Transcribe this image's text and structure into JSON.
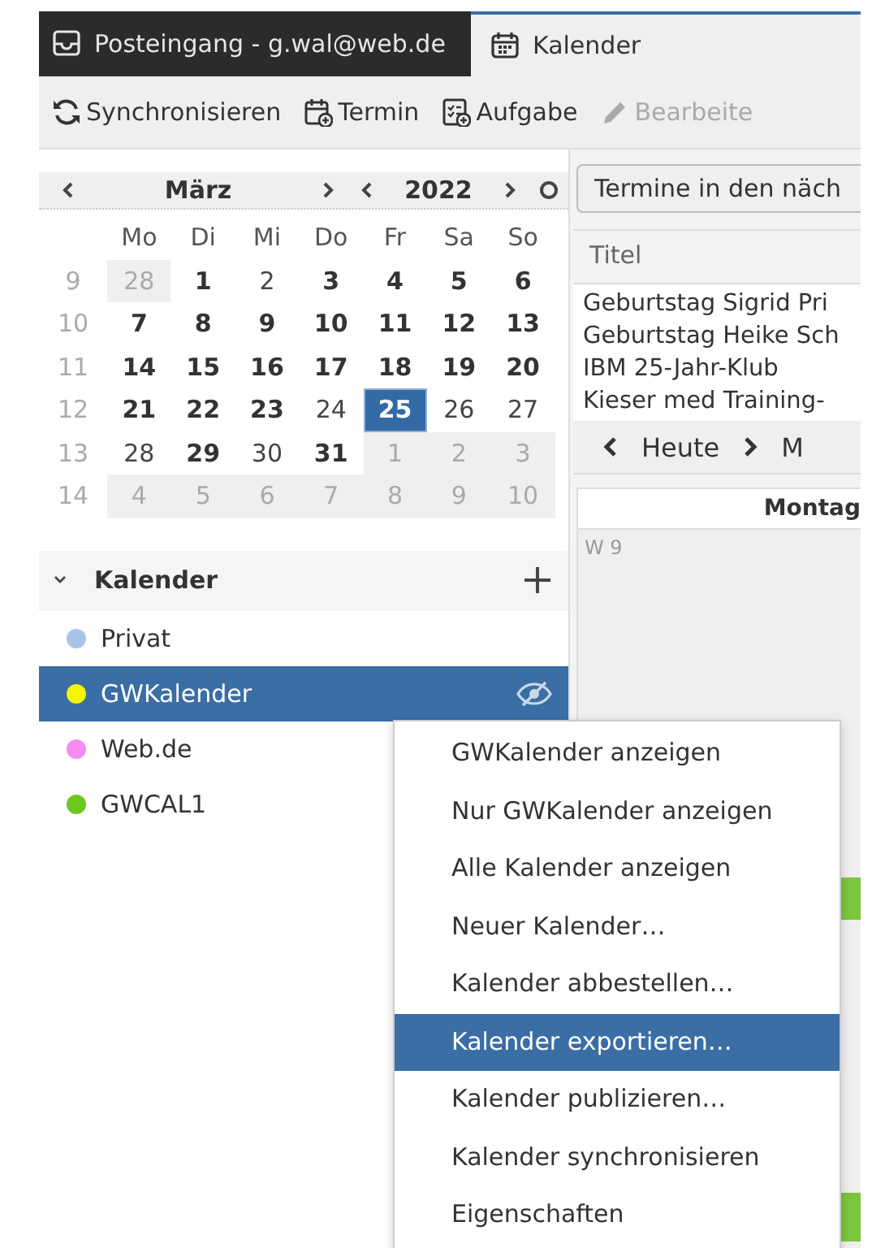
{
  "tabs": [
    {
      "label": "Posteingang - g.wal@web.de",
      "kind": "mail",
      "selected": false
    },
    {
      "label": "Kalender",
      "kind": "calendar",
      "selected": true
    }
  ],
  "toolbar": [
    {
      "label": "Synchronisieren",
      "kind": "sync",
      "disabled": false
    },
    {
      "label": "Termin",
      "kind": "event",
      "disabled": false
    },
    {
      "label": "Aufgabe",
      "kind": "task",
      "disabled": false
    },
    {
      "label": "Bearbeite",
      "kind": "edit",
      "disabled": true
    }
  ],
  "minimonth": {
    "month": "März",
    "year": "2022",
    "weekdays": [
      "Mo",
      "Di",
      "Mi",
      "Do",
      "Fr",
      "Sa",
      "So"
    ],
    "weeks": [
      {
        "number": "9",
        "days": [
          {
            "day": "28",
            "other_month": true,
            "bold": false,
            "selected": false
          },
          {
            "day": "1",
            "other_month": false,
            "bold": true,
            "selected": false
          },
          {
            "day": "2",
            "other_month": false,
            "bold": false,
            "selected": false
          },
          {
            "day": "3",
            "other_month": false,
            "bold": true,
            "selected": false
          },
          {
            "day": "4",
            "other_month": false,
            "bold": true,
            "selected": false
          },
          {
            "day": "5",
            "other_month": false,
            "bold": true,
            "selected": false
          },
          {
            "day": "6",
            "other_month": false,
            "bold": true,
            "selected": false
          }
        ]
      },
      {
        "number": "10",
        "days": [
          {
            "day": "7",
            "other_month": false,
            "bold": true,
            "selected": false
          },
          {
            "day": "8",
            "other_month": false,
            "bold": true,
            "selected": false
          },
          {
            "day": "9",
            "other_month": false,
            "bold": true,
            "selected": false
          },
          {
            "day": "10",
            "other_month": false,
            "bold": true,
            "selected": false
          },
          {
            "day": "11",
            "other_month": false,
            "bold": true,
            "selected": false
          },
          {
            "day": "12",
            "other_month": false,
            "bold": true,
            "selected": false
          },
          {
            "day": "13",
            "other_month": false,
            "bold": true,
            "selected": false
          }
        ]
      },
      {
        "number": "11",
        "days": [
          {
            "day": "14",
            "other_month": false,
            "bold": true,
            "selected": false
          },
          {
            "day": "15",
            "other_month": false,
            "bold": true,
            "selected": false
          },
          {
            "day": "16",
            "other_month": false,
            "bold": true,
            "selected": false
          },
          {
            "day": "17",
            "other_month": false,
            "bold": true,
            "selected": false
          },
          {
            "day": "18",
            "other_month": false,
            "bold": true,
            "selected": false
          },
          {
            "day": "19",
            "other_month": false,
            "bold": true,
            "selected": false
          },
          {
            "day": "20",
            "other_month": false,
            "bold": true,
            "selected": false
          }
        ]
      },
      {
        "number": "12",
        "days": [
          {
            "day": "21",
            "other_month": false,
            "bold": true,
            "selected": false
          },
          {
            "day": "22",
            "other_month": false,
            "bold": true,
            "selected": false
          },
          {
            "day": "23",
            "other_month": false,
            "bold": true,
            "selected": false
          },
          {
            "day": "24",
            "other_month": false,
            "bold": false,
            "selected": false
          },
          {
            "day": "25",
            "other_month": false,
            "bold": true,
            "selected": true
          },
          {
            "day": "26",
            "other_month": false,
            "bold": false,
            "selected": false
          },
          {
            "day": "27",
            "other_month": false,
            "bold": false,
            "selected": false
          }
        ]
      },
      {
        "number": "13",
        "days": [
          {
            "day": "28",
            "other_month": false,
            "bold": false,
            "selected": false
          },
          {
            "day": "29",
            "other_month": false,
            "bold": true,
            "selected": false
          },
          {
            "day": "30",
            "other_month": false,
            "bold": false,
            "selected": false
          },
          {
            "day": "31",
            "other_month": false,
            "bold": true,
            "selected": false
          },
          {
            "day": "1",
            "other_month": true,
            "bold": false,
            "selected": false
          },
          {
            "day": "2",
            "other_month": true,
            "bold": false,
            "selected": false
          },
          {
            "day": "3",
            "other_month": true,
            "bold": false,
            "selected": false
          }
        ]
      },
      {
        "number": "14",
        "days": [
          {
            "day": "4",
            "other_month": true,
            "bold": false,
            "selected": false
          },
          {
            "day": "5",
            "other_month": true,
            "bold": false,
            "selected": false
          },
          {
            "day": "6",
            "other_month": true,
            "bold": false,
            "selected": false
          },
          {
            "day": "7",
            "other_month": true,
            "bold": false,
            "selected": false
          },
          {
            "day": "8",
            "other_month": true,
            "bold": false,
            "selected": false
          },
          {
            "day": "9",
            "other_month": true,
            "bold": false,
            "selected": false
          },
          {
            "day": "10",
            "other_month": true,
            "bold": false,
            "selected": false
          }
        ]
      }
    ]
  },
  "calendars": {
    "title": "Kalender",
    "expanded": true,
    "items": [
      {
        "name": "Privat",
        "color": "#a8c4e6",
        "selected": false,
        "hidden": false
      },
      {
        "name": "GWKalender",
        "color": "#f5f500",
        "selected": true,
        "hidden": true
      },
      {
        "name": "Web.de",
        "color": "#f58cf0",
        "selected": false,
        "hidden": false
      },
      {
        "name": "GWCAL1",
        "color": "#6cc81e",
        "selected": false,
        "hidden": false
      }
    ]
  },
  "agenda": {
    "filter": "Termine in den näch",
    "column": "Titel",
    "rows": [
      "Geburtstag Sigrid Pri",
      "Geburtstag Heike Sch",
      "IBM 25-Jahr-Klub",
      "Kieser med Training-"
    ]
  },
  "view_nav": {
    "today": "Heute",
    "next_label": "M"
  },
  "day_header": "Montag",
  "week_label": "W 9",
  "context_menu": [
    {
      "label": "GWKalender anzeigen",
      "selected": false
    },
    {
      "label": "Nur GWKalender anzeigen",
      "selected": false
    },
    {
      "label": "Alle Kalender anzeigen",
      "selected": false
    },
    {
      "label": "Neuer Kalender…",
      "selected": false
    },
    {
      "label": "Kalender abbestellen…",
      "selected": false
    },
    {
      "label": "Kalender exportieren…",
      "selected": true
    },
    {
      "label": "Kalender publizieren…",
      "selected": false
    },
    {
      "label": "Kalender synchronisieren",
      "selected": false
    },
    {
      "label": "Eigenschaften",
      "selected": false
    }
  ]
}
